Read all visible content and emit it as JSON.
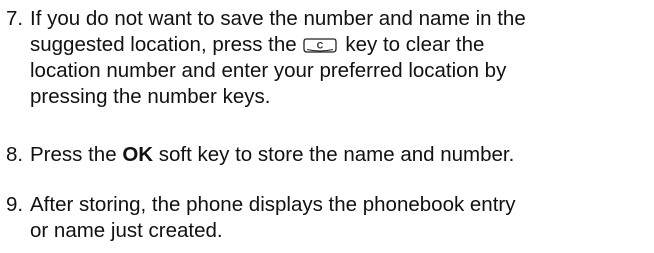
{
  "steps": [
    {
      "number": "7.",
      "lines": {
        "l1": "If you do not want to save the number and name in the",
        "l2_before": "suggested location, press the",
        "l2_after": "key to clear the",
        "l3": "location number and enter your preferred location by",
        "l4": "pressing the number keys."
      },
      "key_icon": {
        "name": "c-key-icon",
        "letter": "C"
      }
    },
    {
      "number": "8.",
      "text_before": "Press the",
      "text_bold": "OK",
      "text_after": "soft key to store the name and number."
    },
    {
      "number": "9.",
      "lines": {
        "l1": "After storing, the phone displays the phonebook entry",
        "l2": "or name just created."
      }
    }
  ],
  "colors": {
    "text": "#111111",
    "key_outline": "#222222"
  }
}
